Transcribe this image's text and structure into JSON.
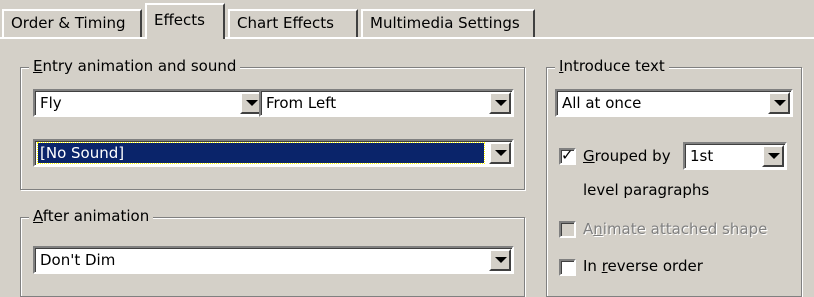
{
  "tabs": [
    {
      "label": "Order & Timing",
      "active": false
    },
    {
      "label": "Effects",
      "active": true
    },
    {
      "label": "Chart Effects",
      "active": false
    },
    {
      "label": "Multimedia Settings",
      "active": false
    }
  ],
  "entry": {
    "legend_prefix": "E",
    "legend_rest": "ntry animation and sound",
    "effect": "Fly",
    "direction": "From Left",
    "sound": "[No Sound]"
  },
  "after": {
    "legend_prefix": "A",
    "legend_rest": "fter animation",
    "value": "Don't Dim"
  },
  "introduce": {
    "legend_prefix": "I",
    "legend_rest": "ntroduce text",
    "value": "All at once",
    "grouped": {
      "prefix": "G",
      "rest": "rouped by",
      "checked": true,
      "level": "1st"
    },
    "level_text": "level paragraphs",
    "animate_shape": {
      "pre": "A",
      "u": "n",
      "rest": "imate attached shape",
      "checked": false,
      "disabled": true
    },
    "reverse": {
      "pre": "In ",
      "u": "r",
      "rest": "everse order",
      "checked": false
    }
  }
}
